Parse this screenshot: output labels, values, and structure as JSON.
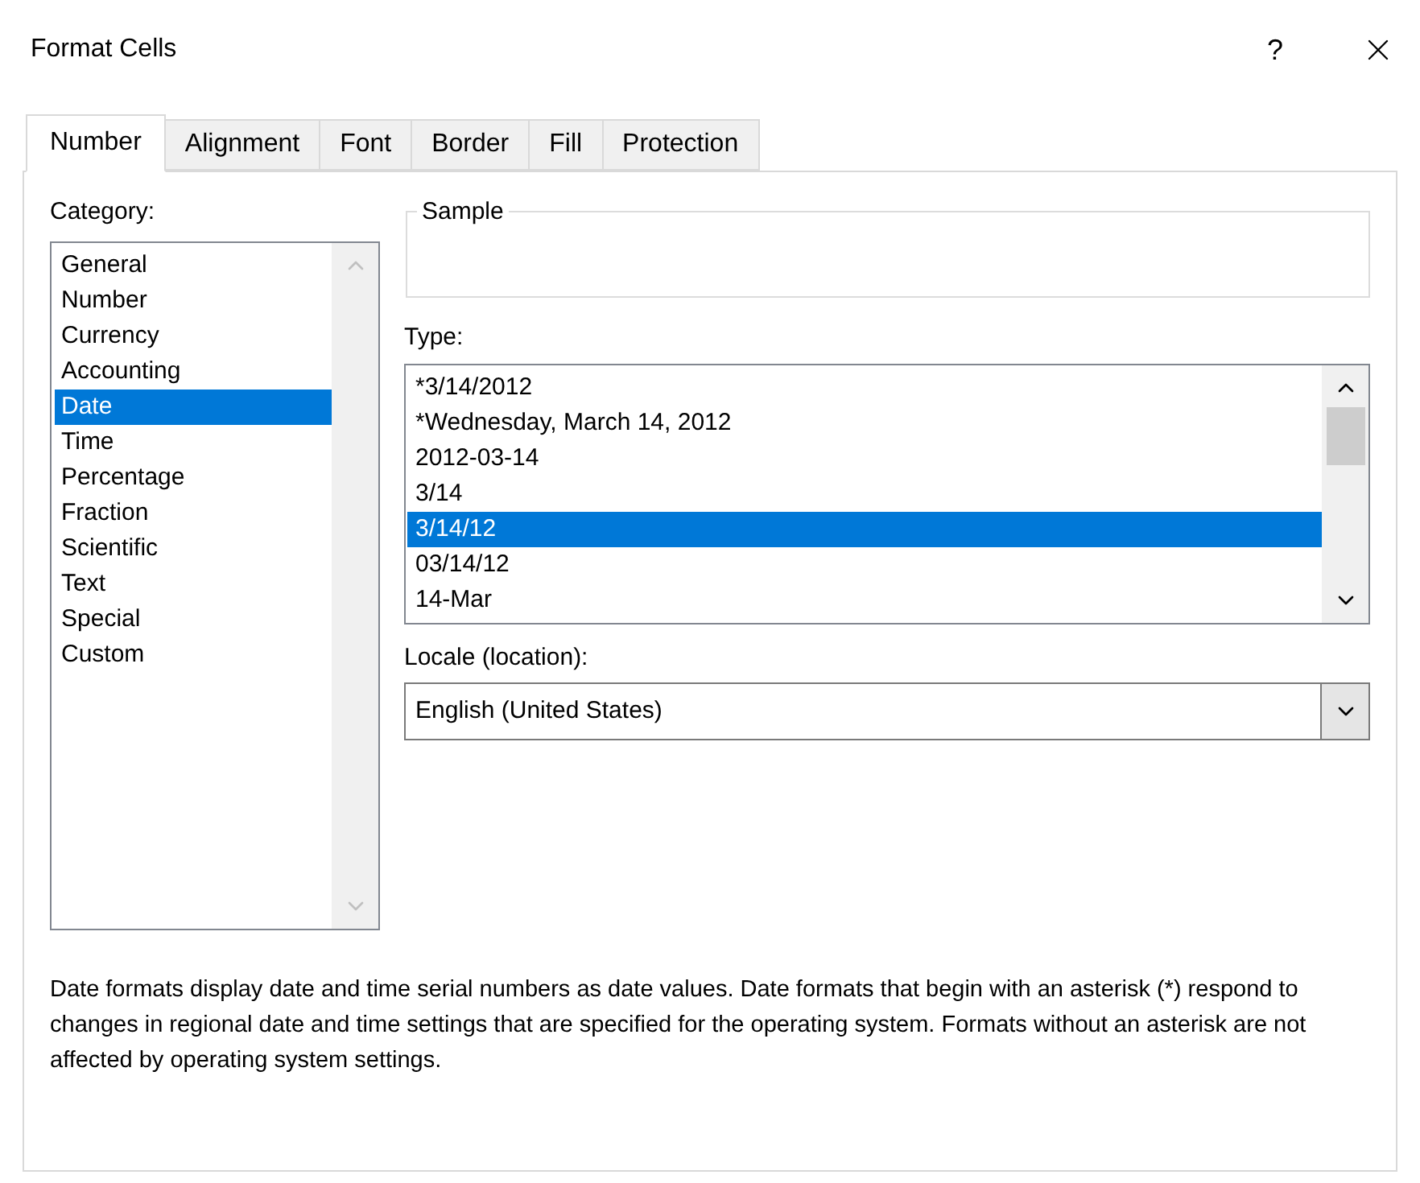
{
  "window": {
    "title": "Format Cells",
    "help": "?"
  },
  "tabs": [
    {
      "label": "Number",
      "selected": true
    },
    {
      "label": "Alignment",
      "selected": false
    },
    {
      "label": "Font",
      "selected": false
    },
    {
      "label": "Border",
      "selected": false
    },
    {
      "label": "Fill",
      "selected": false
    },
    {
      "label": "Protection",
      "selected": false
    }
  ],
  "category": {
    "label": "Category:",
    "items": [
      {
        "label": "General",
        "selected": false
      },
      {
        "label": "Number",
        "selected": false
      },
      {
        "label": "Currency",
        "selected": false
      },
      {
        "label": "Accounting",
        "selected": false
      },
      {
        "label": "Date",
        "selected": true
      },
      {
        "label": "Time",
        "selected": false
      },
      {
        "label": "Percentage",
        "selected": false
      },
      {
        "label": "Fraction",
        "selected": false
      },
      {
        "label": "Scientific",
        "selected": false
      },
      {
        "label": "Text",
        "selected": false
      },
      {
        "label": "Special",
        "selected": false
      },
      {
        "label": "Custom",
        "selected": false
      }
    ]
  },
  "sample": {
    "label": "Sample"
  },
  "type": {
    "label": "Type:",
    "items": [
      {
        "label": "*3/14/2012",
        "selected": false
      },
      {
        "label": "*Wednesday, March 14, 2012",
        "selected": false
      },
      {
        "label": "2012-03-14",
        "selected": false
      },
      {
        "label": "3/14",
        "selected": false
      },
      {
        "label": "3/14/12",
        "selected": true
      },
      {
        "label": "03/14/12",
        "selected": false
      },
      {
        "label": "14-Mar",
        "selected": false
      }
    ]
  },
  "locale": {
    "label": "Locale (location):",
    "value": "English (United States)"
  },
  "description": "Date formats display date and time serial numbers as date values.  Date formats that begin with an asterisk (*) respond to changes in regional date and time settings that are specified for the operating system. Formats without an asterisk are not affected by operating system settings."
}
